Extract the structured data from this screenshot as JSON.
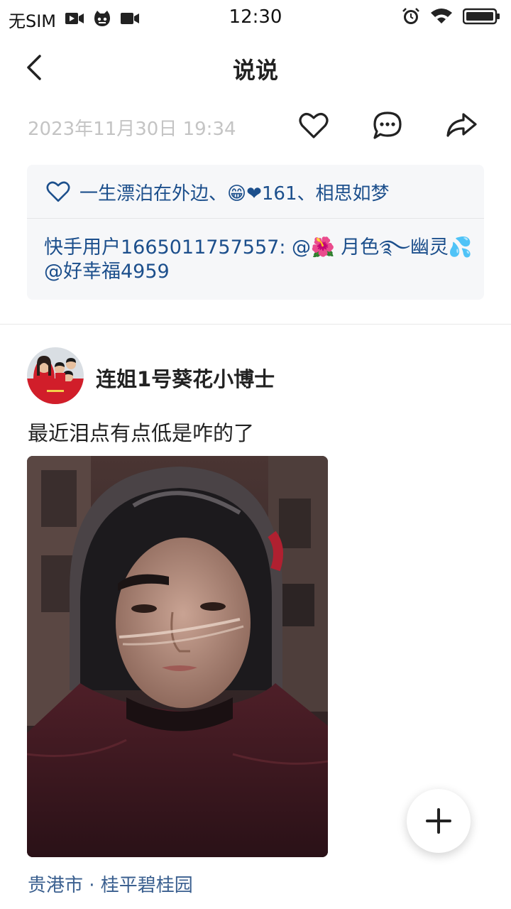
{
  "status_bar": {
    "carrier": "无SIM",
    "time": "12:30"
  },
  "nav": {
    "title": "说说"
  },
  "post": {
    "timestamp": "2023年11月30日 19:34"
  },
  "interaction": {
    "likes_text": "一生漂泊在外边、😁❤161、相思如梦",
    "comment": {
      "author": "快手用户1665011757557",
      "text": ": @🌺 月色࿐幽灵💦 @好幸福4959"
    }
  },
  "feed_item": {
    "author_name": "连姐1号葵花小博士",
    "text": "最近泪点有点低是咋的了",
    "location": "贵港市 · 桂平碧桂园"
  },
  "colors": {
    "link_blue": "#1c4f8c",
    "muted_gray": "#c4c4c4",
    "box_bg": "#f6f7f9"
  }
}
